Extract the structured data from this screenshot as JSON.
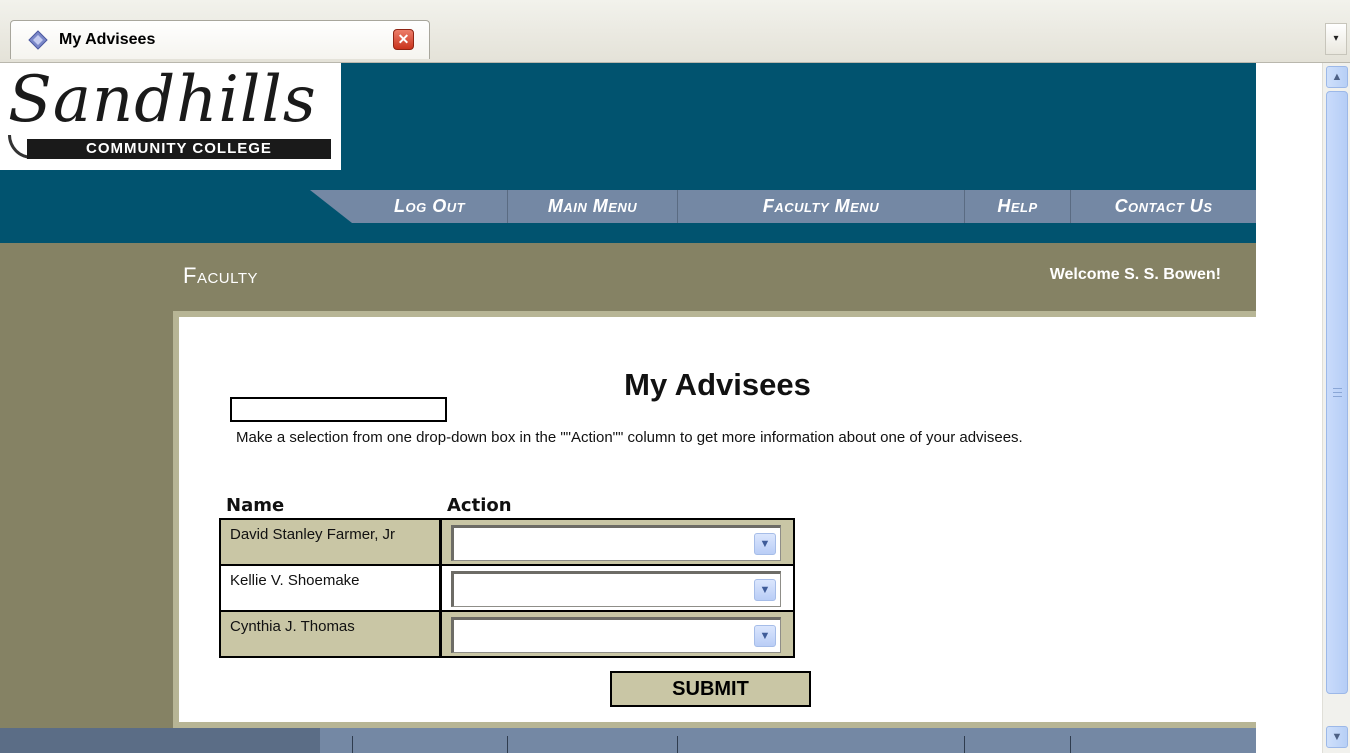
{
  "browser": {
    "tab_title": "My Advisees",
    "tab_icon": "diamond-page-icon"
  },
  "header": {
    "logo_script": "Sandhills",
    "logo_subtitle": "COMMUNITY COLLEGE",
    "colors": {
      "banner": "#01536f",
      "nav": "#7488a4",
      "olive": "#858264",
      "cell_shade": "#c9c6a5"
    }
  },
  "nav": {
    "items": [
      "Log Out",
      "Main Menu",
      "Faculty Menu",
      "Help",
      "Contact Us"
    ]
  },
  "section": {
    "title": "Faculty",
    "welcome": "Welcome S. S. Bowen!"
  },
  "main": {
    "heading": "My Advisees",
    "instructions": "Make a selection from one drop-down box in the \"\"Action\"\" column to get more information about one of your advisees.",
    "columns": {
      "name": "Name",
      "action": "Action"
    },
    "advisees": [
      {
        "name": "David Stanley Farmer, Jr",
        "action": ""
      },
      {
        "name": "Kellie V. Shoemake",
        "action": ""
      },
      {
        "name": "Cynthia J. Thomas",
        "action": ""
      }
    ],
    "submit_label": "SUBMIT"
  }
}
